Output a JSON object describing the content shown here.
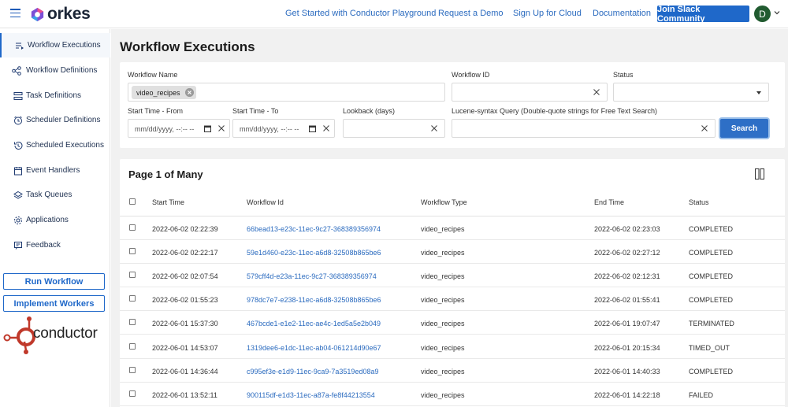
{
  "header": {
    "brand": "orkes",
    "nav_links": [
      {
        "label": "Get Started with Conductor Playground"
      },
      {
        "label": "Request a Demo"
      },
      {
        "label": "Sign Up for Cloud"
      },
      {
        "label": "Documentation"
      }
    ],
    "cta_label": "Join Slack Community",
    "avatar_initial": "D"
  },
  "sidebar": {
    "items": [
      {
        "label": "Workflow Executions",
        "icon": "list-play-icon",
        "active": true
      },
      {
        "label": "Workflow Definitions",
        "icon": "flow-icon"
      },
      {
        "label": "Task Definitions",
        "icon": "task-list-icon"
      },
      {
        "label": "Scheduler Definitions",
        "icon": "clock-icon"
      },
      {
        "label": "Scheduled Executions",
        "icon": "history-icon"
      },
      {
        "label": "Event Handlers",
        "icon": "calendar-icon"
      },
      {
        "label": "Task Queues",
        "icon": "layers-icon"
      },
      {
        "label": "Applications",
        "icon": "gear-icon"
      },
      {
        "label": "Feedback",
        "icon": "feedback-icon"
      }
    ],
    "run_workflow_label": "Run Workflow",
    "implement_workers_label": "Implement Workers",
    "conductor_brand": "conductor"
  },
  "page": {
    "title": "Workflow Executions"
  },
  "filters": {
    "workflow_name_label": "Workflow Name",
    "workflow_name_chip": "video_recipes",
    "workflow_id_label": "Workflow ID",
    "status_label": "Status",
    "start_from_label": "Start Time - From",
    "start_to_label": "Start Time - To",
    "date_placeholder": "mm/dd/yyyy, --:-- --",
    "lookback_label": "Lookback (days)",
    "lucene_label": "Lucene-syntax Query (Double-quote strings for Free Text Search)",
    "search_label": "Search"
  },
  "results": {
    "title": "Page 1 of Many",
    "columns": [
      "Start Time",
      "Workflow Id",
      "Workflow Type",
      "End Time",
      "Status"
    ],
    "rows": [
      {
        "start": "2022-06-02 02:22:39",
        "id": "66bead13-e23c-11ec-9c27-368389356974",
        "type": "video_recipes",
        "end": "2022-06-02 02:23:03",
        "status": "COMPLETED"
      },
      {
        "start": "2022-06-02 02:22:17",
        "id": "59e1d460-e23c-11ec-a6d8-32508b865be6",
        "type": "video_recipes",
        "end": "2022-06-02 02:27:12",
        "status": "COMPLETED"
      },
      {
        "start": "2022-06-02 02:07:54",
        "id": "579cff4d-e23a-11ec-9c27-368389356974",
        "type": "video_recipes",
        "end": "2022-06-02 02:12:31",
        "status": "COMPLETED"
      },
      {
        "start": "2022-06-02 01:55:23",
        "id": "978dc7e7-e238-11ec-a6d8-32508b865be6",
        "type": "video_recipes",
        "end": "2022-06-02 01:55:41",
        "status": "COMPLETED"
      },
      {
        "start": "2022-06-01 15:37:30",
        "id": "467bcde1-e1e2-11ec-ae4c-1ed5a5e2b049",
        "type": "video_recipes",
        "end": "2022-06-01 19:07:47",
        "status": "TERMINATED"
      },
      {
        "start": "2022-06-01 14:53:07",
        "id": "1319dee6-e1dc-11ec-ab04-061214d90e67",
        "type": "video_recipes",
        "end": "2022-06-01 20:15:34",
        "status": "TIMED_OUT"
      },
      {
        "start": "2022-06-01 14:36:44",
        "id": "c995ef3e-e1d9-11ec-9ca9-7a3519ed08a9",
        "type": "video_recipes",
        "end": "2022-06-01 14:40:33",
        "status": "COMPLETED"
      },
      {
        "start": "2022-06-01 13:52:11",
        "id": "900115df-e1d3-11ec-a87a-fe8f44213554",
        "type": "video_recipes",
        "end": "2022-06-01 14:22:18",
        "status": "FAILED"
      }
    ]
  },
  "colors": {
    "accent": "#1f68c9",
    "link": "#2b6bbf",
    "background": "#f1f1f1"
  }
}
